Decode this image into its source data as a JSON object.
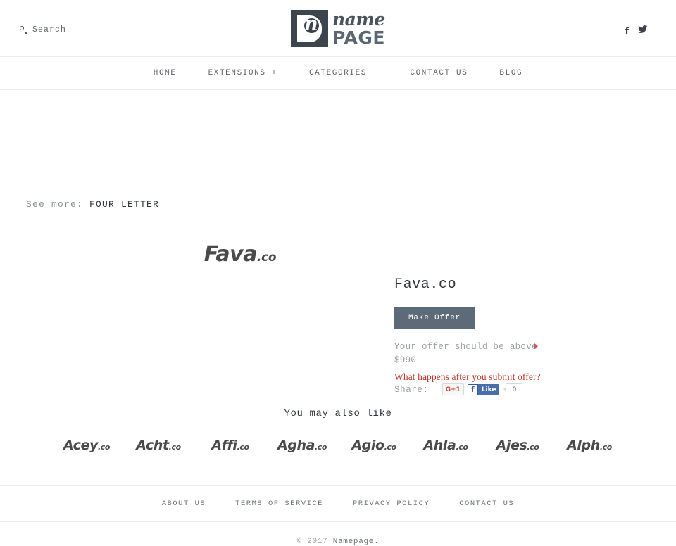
{
  "header": {
    "search": {
      "label": "Search",
      "icon": "search-icon"
    },
    "logo": {
      "mark_letter": "n",
      "name": "name",
      "page": "PAGE"
    },
    "social": [
      {
        "name": "facebook-icon",
        "glyph": "f"
      },
      {
        "name": "twitter-icon",
        "glyph": "ᵕ"
      }
    ]
  },
  "nav": {
    "items": [
      {
        "label": "HOME",
        "name": "nav-item-home"
      },
      {
        "label": "EXTENSIONS +",
        "name": "nav-item-extensions"
      },
      {
        "label": "CATEGORIES +",
        "name": "nav-item-categories"
      },
      {
        "label": "CONTACT US",
        "name": "nav-item-contact-us"
      },
      {
        "label": "BLOG",
        "name": "nav-item-blog"
      }
    ]
  },
  "breadcrumb": {
    "prefix": "See more:",
    "category": "FOUR LETTER"
  },
  "listing": {
    "art_name": "Fava",
    "art_tld": ".co",
    "title": "Fava.co",
    "make_offer_label": "Make Offer",
    "offer_note": "Your offer should be above $990",
    "minimum_price": "$990",
    "offer_link": "What happens after you submit offer?",
    "share_label": "Share:",
    "gplus_label": "G+1",
    "fb_icon": "f",
    "fb_like_label": "Like",
    "fb_count": "0"
  },
  "related": {
    "title": "You may also like",
    "items": [
      {
        "name": "Acey",
        "tld": ".co"
      },
      {
        "name": "Acht",
        "tld": ".co"
      },
      {
        "name": "Affi",
        "tld": ".co"
      },
      {
        "name": "Agha",
        "tld": ".co"
      },
      {
        "name": "Agio",
        "tld": ".co"
      },
      {
        "name": "Ahla",
        "tld": ".co"
      },
      {
        "name": "Ajes",
        "tld": ".co"
      },
      {
        "name": "Alph",
        "tld": ".co"
      }
    ]
  },
  "footer": {
    "links": [
      {
        "label": "ABOUT US",
        "name": "footer-link-about-us"
      },
      {
        "label": "TERMS OF SERVICE",
        "name": "footer-link-terms-of-service"
      },
      {
        "label": "PRIVACY POLICY",
        "name": "footer-link-privacy-policy"
      },
      {
        "label": "CONTACT US",
        "name": "footer-link-contact-us"
      }
    ],
    "copyright_prefix": "© 2017",
    "brand": "Namepage."
  },
  "colors": {
    "accent_button": "#5d6b78",
    "link_red": "#c0392b",
    "logo_dark": "#3c444d",
    "text_dark": "#2f353b",
    "text_muted": "#9a9ea3"
  }
}
